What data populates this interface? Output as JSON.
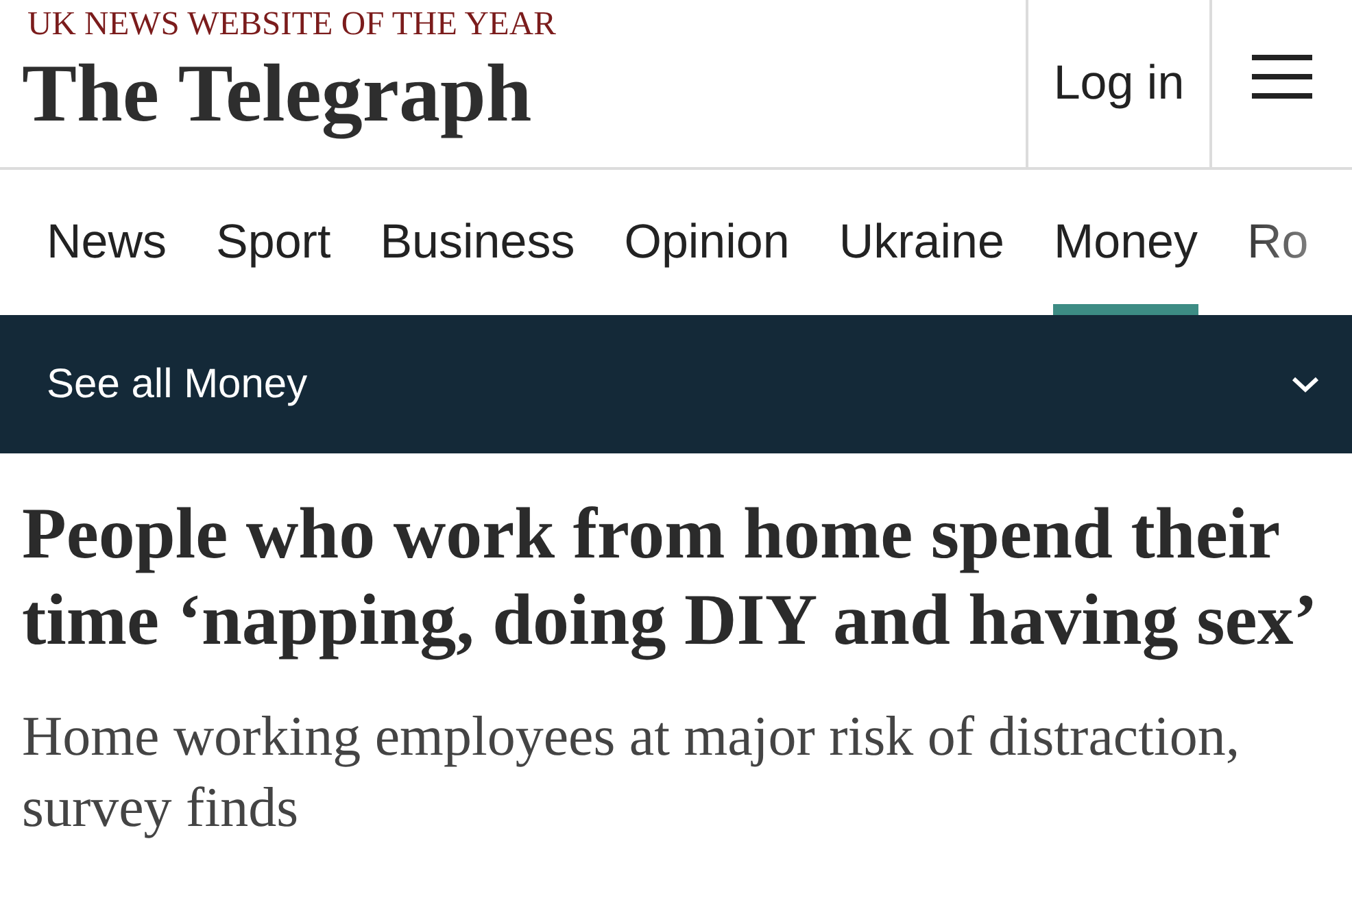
{
  "header": {
    "tagline": "UK NEWS WEBSITE OF THE YEAR",
    "logo": "The Telegraph",
    "login": "Log in"
  },
  "nav": {
    "items": [
      {
        "label": "News",
        "selected": false
      },
      {
        "label": "Sport",
        "selected": false
      },
      {
        "label": "Business",
        "selected": false
      },
      {
        "label": "Opinion",
        "selected": false
      },
      {
        "label": "Ukraine",
        "selected": false
      },
      {
        "label": "Money",
        "selected": true
      },
      {
        "label": "Ro",
        "selected": false
      }
    ]
  },
  "section_bar": {
    "label": "See all Money",
    "expanded": false
  },
  "article": {
    "headline": "People who work from home spend their time ‘napping, doing DIY and having sex’",
    "standfirst": "Home working employees at major risk of distraction, survey finds"
  }
}
